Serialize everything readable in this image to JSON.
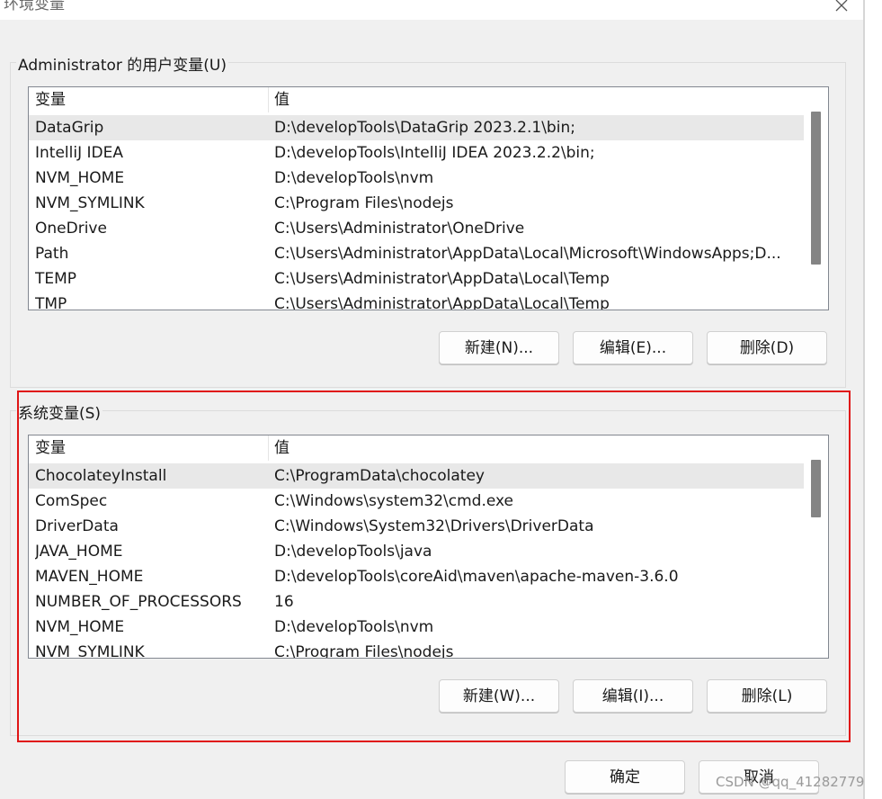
{
  "window": {
    "title": "环境变量"
  },
  "user_vars": {
    "group_label": "Administrator 的用户变量(U)",
    "columns": [
      "变量",
      "值"
    ],
    "rows": [
      {
        "name": "DataGrip",
        "value": "D:\\developTools\\DataGrip 2023.2.1\\bin;"
      },
      {
        "name": "IntelliJ IDEA",
        "value": "D:\\developTools\\IntelliJ IDEA 2023.2.2\\bin;"
      },
      {
        "name": "NVM_HOME",
        "value": "D:\\developTools\\nvm"
      },
      {
        "name": "NVM_SYMLINK",
        "value": "C:\\Program Files\\nodejs"
      },
      {
        "name": "OneDrive",
        "value": "C:\\Users\\Administrator\\OneDrive"
      },
      {
        "name": "Path",
        "value": "C:\\Users\\Administrator\\AppData\\Local\\Microsoft\\WindowsApps;D..."
      },
      {
        "name": "TEMP",
        "value": "C:\\Users\\Administrator\\AppData\\Local\\Temp"
      },
      {
        "name": "TMP",
        "value": "C:\\Users\\Administrator\\AppData\\Local\\Temp"
      }
    ],
    "buttons": {
      "new": "新建(N)...",
      "edit": "编辑(E)...",
      "delete": "删除(D)"
    }
  },
  "system_vars": {
    "group_label": "系统变量(S)",
    "columns": [
      "变量",
      "值"
    ],
    "rows": [
      {
        "name": "ChocolateyInstall",
        "value": "C:\\ProgramData\\chocolatey"
      },
      {
        "name": "ComSpec",
        "value": "C:\\Windows\\system32\\cmd.exe"
      },
      {
        "name": "DriverData",
        "value": "C:\\Windows\\System32\\Drivers\\DriverData"
      },
      {
        "name": "JAVA_HOME",
        "value": "D:\\developTools\\java"
      },
      {
        "name": "MAVEN_HOME",
        "value": "D:\\developTools\\coreAid\\maven\\apache-maven-3.6.0"
      },
      {
        "name": "NUMBER_OF_PROCESSORS",
        "value": "16"
      },
      {
        "name": "NVM_HOME",
        "value": "D:\\developTools\\nvm"
      },
      {
        "name": "NVM_SYMLINK",
        "value": "C:\\Program Files\\nodejs"
      }
    ],
    "buttons": {
      "new": "新建(W)...",
      "edit": "编辑(I)...",
      "delete": "删除(L)"
    }
  },
  "footer": {
    "ok": "确定",
    "cancel": "取消"
  },
  "watermark": "CSDN @qq_41282779",
  "colors": {
    "highlight_box": "#e01515",
    "selected_row": "#e8e8e8",
    "dialog_bg": "#f0f0f0"
  }
}
